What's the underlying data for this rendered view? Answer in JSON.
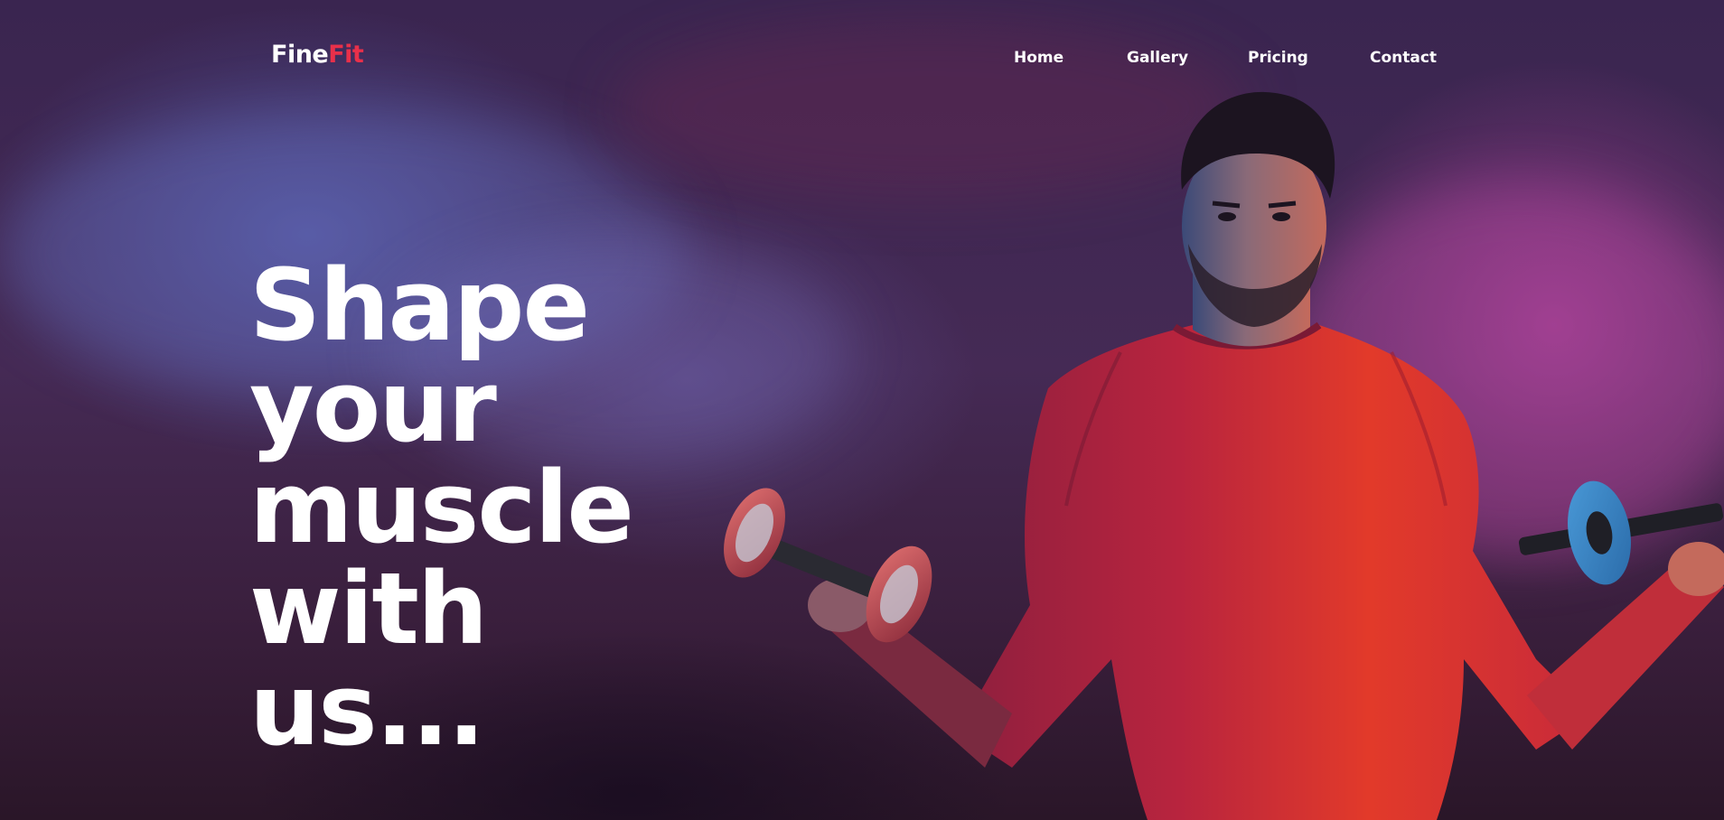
{
  "brand": {
    "name_prefix": "Fine",
    "name_suffix": "Fit",
    "accent_color": "#e8304a"
  },
  "nav": {
    "items": [
      "Home",
      "Gallery",
      "Pricing",
      "Contact"
    ]
  },
  "hero": {
    "headline_lines": [
      "Shape",
      "your",
      "muscle",
      "with",
      "us..."
    ],
    "image": "athlete-with-dumbbells-photo"
  },
  "colors": {
    "text": "#ffffff",
    "background_blue": "#5c6ec8",
    "background_magenta": "#c846aa",
    "shirt_red": "#d8304a"
  }
}
